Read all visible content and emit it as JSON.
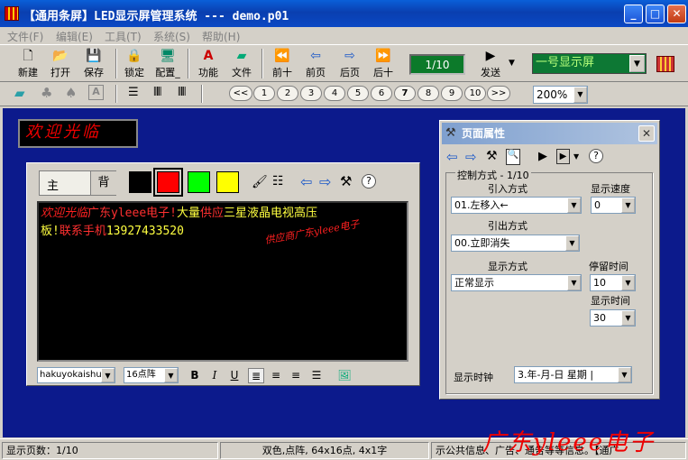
{
  "window": {
    "title": "【通用条屏】LED显示屏管理系统 --- demo.p01",
    "minimize": "_",
    "maximize": "□",
    "close": "✕"
  },
  "menu": [
    "文件(F)",
    "编辑(E)",
    "工具(T)",
    "系统(S)",
    "帮助(H)"
  ],
  "toolbar": {
    "new": "新建",
    "open": "打开",
    "save": "保存",
    "lock": "锁定",
    "config": "配置_",
    "function": "功能",
    "file": "文件",
    "first": "前十",
    "prev": "前页",
    "next": "后页",
    "last": "后十",
    "page_counter": "1/10",
    "send": "发送",
    "display": "一号显示屏"
  },
  "page_buttons": [
    "<<",
    "1",
    "2",
    "3",
    "4",
    "5",
    "6",
    "7",
    "8",
    "9",
    "10",
    ">>"
  ],
  "zoom": "200%",
  "led_preview": "欢迎光临",
  "editor": {
    "tab_main": "主",
    "tab_back": "背",
    "line1": [
      {
        "text": "欢迎光临",
        "color": "#ff2020"
      },
      {
        "text": "广东yleee电子!",
        "color": "#ff3030"
      },
      {
        "text": "大量",
        "color": "#ffff40"
      },
      {
        "text": "供应",
        "color": "#ff3030"
      },
      {
        "text": "三星液晶电视高压",
        "color": "#ffff40"
      }
    ],
    "line2": [
      {
        "text": "板!",
        "color": "#ffff40"
      },
      {
        "text": "联系手机",
        "color": "#ff3030"
      },
      {
        "text": "13927433520",
        "color": "#ffff40"
      }
    ],
    "watermark": "供应商广东yleee电子",
    "font": "hakuyokaishu",
    "size": "16点阵",
    "bold": "B",
    "italic": "I",
    "underline": "U"
  },
  "swatches": {
    "black": "#000000",
    "red": "#ff0000",
    "green": "#00ff00",
    "yellow": "#ffff00"
  },
  "props": {
    "title": "页面属性",
    "group": "控制方式 - 1/10",
    "entry_label": "引入方式",
    "entry_value": "01.左移入←",
    "speed_label": "显示速度",
    "speed_value": "0",
    "exit_label": "引出方式",
    "exit_value": "00.立即消失",
    "mode_label": "显示方式",
    "mode_value": "正常显示",
    "stay_label": "停留时间",
    "stay_value": "10",
    "duration_label": "显示时间",
    "duration_value": "30",
    "clock_label": "显示时钟",
    "clock_value": "3.年-月-日 星期 |"
  },
  "status": {
    "pages": "显示页数：1/10",
    "info": "双色,点阵, 64x16点, 4x1字",
    "ticker": "示公共信息、广告、通告等等信息。【通广",
    "watermark": "广东yleee电子"
  }
}
